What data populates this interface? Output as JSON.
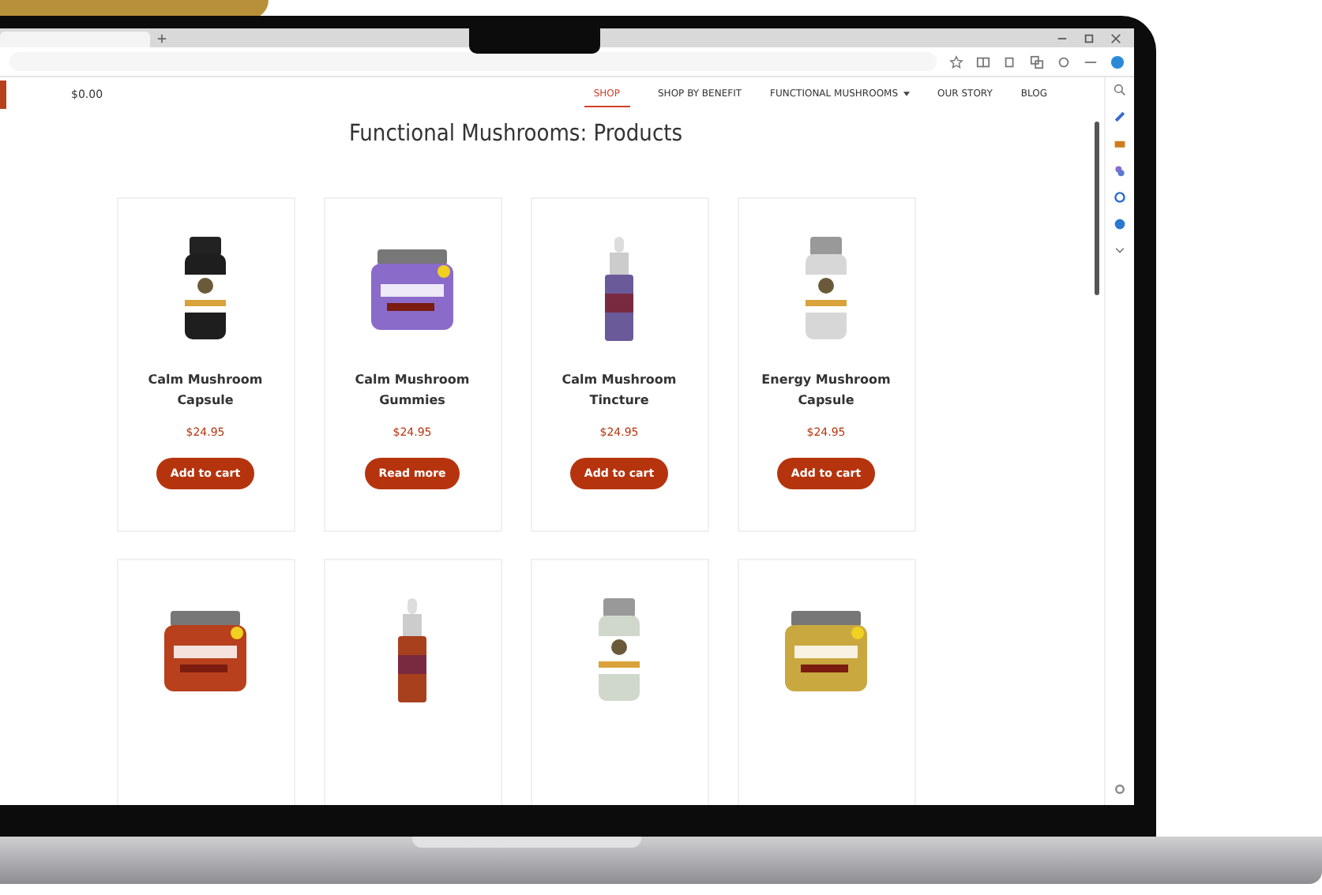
{
  "header": {
    "cart_total": "$0.00"
  },
  "nav": [
    {
      "label": "SHOP",
      "selected": true,
      "dropdown": false
    },
    {
      "label": "SHOP BY BENEFIT",
      "selected": false,
      "dropdown": false
    },
    {
      "label": "FUNCTIONAL MUSHROOMS",
      "selected": false,
      "dropdown": true
    },
    {
      "label": "OUR STORY",
      "selected": false,
      "dropdown": false
    },
    {
      "label": "BLOG",
      "selected": false,
      "dropdown": false
    }
  ],
  "page_title": "Functional Mushrooms: Products",
  "products": [
    {
      "image": {
        "kind": "bottle",
        "color": "#1e1e1e"
      },
      "name": "Calm Mushroom Capsule",
      "price": "$24.95",
      "button": "Add to cart"
    },
    {
      "image": {
        "kind": "jar",
        "color": "#8a6bc9"
      },
      "name": "Calm Mushroom Gummies",
      "price": "$24.95",
      "button": "Read more"
    },
    {
      "image": {
        "kind": "dropper",
        "color": "#6a5a9a"
      },
      "name": "Calm Mushroom Tincture",
      "price": "$24.95",
      "button": "Add to cart"
    },
    {
      "image": {
        "kind": "bottle",
        "color": "#d7d7d7"
      },
      "name": "Energy Mushroom Capsule",
      "price": "$24.95",
      "button": "Add to cart"
    },
    {
      "image": {
        "kind": "jar",
        "color": "#b8401c"
      }
    },
    {
      "image": {
        "kind": "dropper",
        "color": "#a8401e"
      }
    },
    {
      "image": {
        "kind": "bottle",
        "color": "#d0d8cc"
      }
    },
    {
      "image": {
        "kind": "jar",
        "color": "#c9a840"
      }
    }
  ]
}
